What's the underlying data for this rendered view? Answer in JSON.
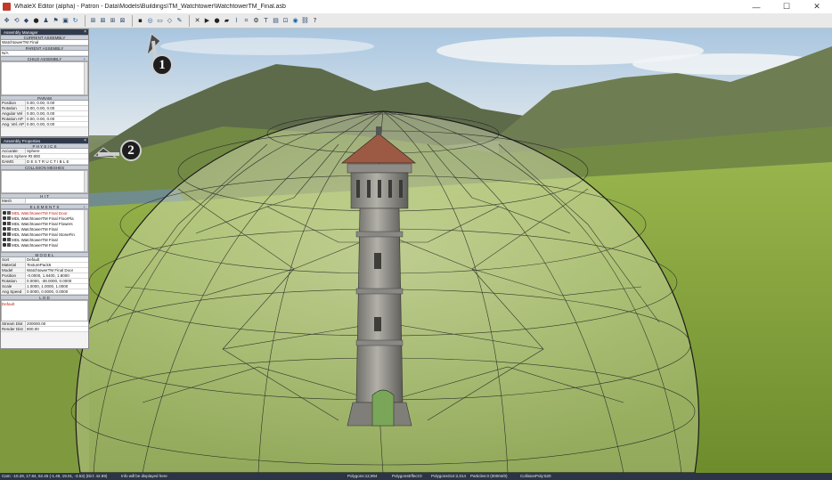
{
  "window": {
    "title": "WhaleX Editor (alpha) - Patron - Data\\Models\\Buildings\\TM_Watchtower\\WatchtowerTM_Final.asb",
    "minimize": "—",
    "maximize": "☐",
    "close": "✕"
  },
  "toolbar": {
    "icons": [
      "move-icon",
      "rotate-icon",
      "scale-icon",
      "sphere-icon",
      "person-icon",
      "camera-icon",
      "cube-icon",
      "refresh-icon",
      "grid-icon",
      "grid-icon",
      "grid-icon",
      "grid-icon",
      "select-icon",
      "collision-sphere-icon",
      "box-icon",
      "mesh-icon",
      "paint-icon",
      "wrench-icon",
      "play-icon",
      "record-icon",
      "brush-icon",
      "measure-icon",
      "crop-icon",
      "settings-icon",
      "text-icon",
      "camera-icon",
      "mesh-icon",
      "eye-icon",
      "link-icon",
      "help-icon"
    ]
  },
  "assembly_manager": {
    "title": "Assembly Manager",
    "current_assembly_header": "CURRENT ASSEMBLY",
    "current_assembly_value": "WatchtowerTM Final",
    "parent_assembly_header": "PARENT ASSEMBLY",
    "parent_assembly_value": "N/A",
    "child_assembly_header": "CHILD ASSEMBLY",
    "param_header": "PARAM",
    "params": [
      {
        "key": "Position",
        "value": "0.00, 0.00, 0.00"
      },
      {
        "key": "Rotation",
        "value": "0.00, 0.00, 0.00"
      },
      {
        "key": "Angular Vel",
        "value": "0.00, 0.00, 0.00"
      },
      {
        "key": "Rotation AP",
        "value": "0.00, 0.00, 0.00"
      },
      {
        "key": "Ang. Vel. AP",
        "value": "0.00, 0.00, 0.00"
      }
    ]
  },
  "assembly_properties": {
    "title": "Assembly Properties",
    "physics_header": "P H Y S I C S",
    "physics_row_key": "Accurate",
    "physics_row_value": "Sphere",
    "collision_sphere": "Bouns Sphere Rt 800",
    "damage_label": "DAMG",
    "damage_value": "D E S T R U C T I B L E",
    "collision_meshes_header": "COLLISION MESHES",
    "hit_header": "H I T",
    "hit_row_key": "Mesh",
    "elements_header": "E L E M E N T S",
    "elements": [
      {
        "name": "MDL WatchtowerTM Final Door",
        "selected": true
      },
      {
        "name": "MDL WatchtowerTM Final FloorPla",
        "selected": false
      },
      {
        "name": "MDL WatchtowerTM Final Flowers",
        "selected": false
      },
      {
        "name": "MDL WatchtowerTM Final",
        "selected": false
      },
      {
        "name": "MDL WatchtowerTM Final StoneFin",
        "selected": false
      },
      {
        "name": "MDL WatchtowerTM Final",
        "selected": false
      },
      {
        "name": "MDL WatchtowerTM Final",
        "selected": false
      }
    ],
    "model_header": "M O D E L",
    "model_rows": [
      {
        "key": "Sort",
        "value": "Default"
      },
      {
        "key": "Material",
        "value": "TexturePack6"
      },
      {
        "key": "Model",
        "value": "WatchtowerTM Final Door"
      },
      {
        "key": "Position",
        "value": "-0.0000, 1.8400, 1.8000"
      },
      {
        "key": "Rotation",
        "value": "0.0000, -38.0000, 0.0000"
      },
      {
        "key": "Scale",
        "value": "1.0000, 1.0000, 1.0000"
      },
      {
        "key": "Ang Speed",
        "value": "0.0000, 0.0000, 0.0000"
      }
    ],
    "lod_header": "L O D",
    "lod_items": [
      "Default"
    ],
    "lod_rows": [
      {
        "key": "Stream Dist",
        "value": "200000.00"
      },
      {
        "key": "Render Dist",
        "value": "800.00"
      }
    ]
  },
  "callouts": [
    "1",
    "2"
  ],
  "status": {
    "camera": "Cam: -10.29, 17.84, 52.45 (-1.49, 19.01, -3.53) (Dirt: 42.89)",
    "message": "Info will be displayed here",
    "polygons": "Polygons:12,904",
    "polygons_effect": "PolygonsEffect:0",
    "polygons_gui": "PolygonsGUI:2,014",
    "particles": "Particles:0 (00004/0)",
    "collision_poly": "CollisionPoly:520"
  }
}
